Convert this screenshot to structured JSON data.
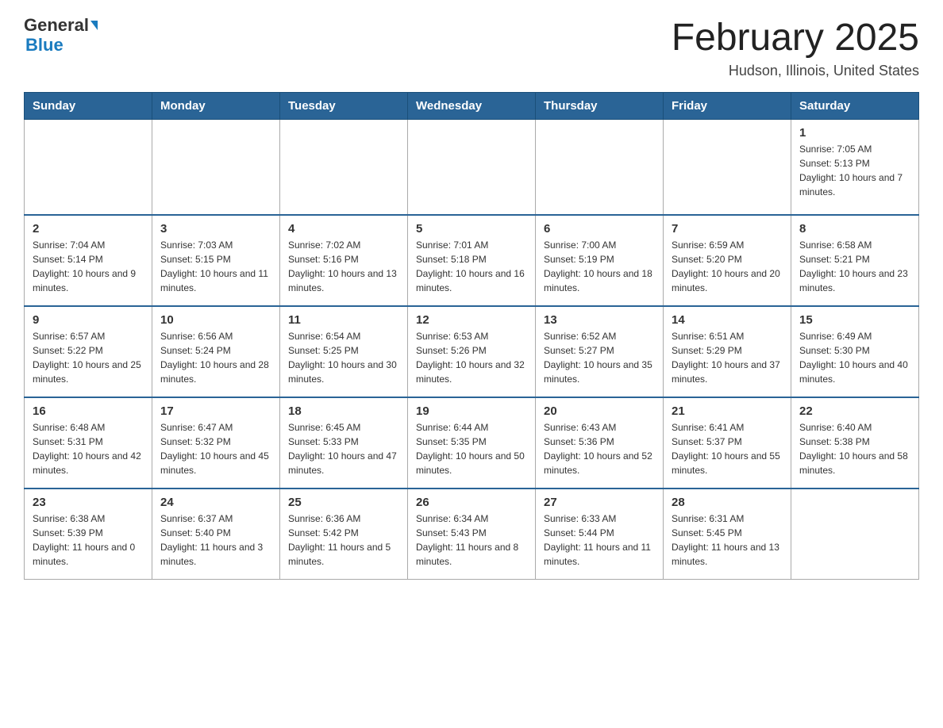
{
  "header": {
    "logo_line1": "General",
    "logo_line2": "Blue",
    "title": "February 2025",
    "subtitle": "Hudson, Illinois, United States"
  },
  "days_of_week": [
    "Sunday",
    "Monday",
    "Tuesday",
    "Wednesday",
    "Thursday",
    "Friday",
    "Saturday"
  ],
  "weeks": [
    [
      {
        "day": "",
        "sunrise": "",
        "sunset": "",
        "daylight": ""
      },
      {
        "day": "",
        "sunrise": "",
        "sunset": "",
        "daylight": ""
      },
      {
        "day": "",
        "sunrise": "",
        "sunset": "",
        "daylight": ""
      },
      {
        "day": "",
        "sunrise": "",
        "sunset": "",
        "daylight": ""
      },
      {
        "day": "",
        "sunrise": "",
        "sunset": "",
        "daylight": ""
      },
      {
        "day": "",
        "sunrise": "",
        "sunset": "",
        "daylight": ""
      },
      {
        "day": "1",
        "sunrise": "Sunrise: 7:05 AM",
        "sunset": "Sunset: 5:13 PM",
        "daylight": "Daylight: 10 hours and 7 minutes."
      }
    ],
    [
      {
        "day": "2",
        "sunrise": "Sunrise: 7:04 AM",
        "sunset": "Sunset: 5:14 PM",
        "daylight": "Daylight: 10 hours and 9 minutes."
      },
      {
        "day": "3",
        "sunrise": "Sunrise: 7:03 AM",
        "sunset": "Sunset: 5:15 PM",
        "daylight": "Daylight: 10 hours and 11 minutes."
      },
      {
        "day": "4",
        "sunrise": "Sunrise: 7:02 AM",
        "sunset": "Sunset: 5:16 PM",
        "daylight": "Daylight: 10 hours and 13 minutes."
      },
      {
        "day": "5",
        "sunrise": "Sunrise: 7:01 AM",
        "sunset": "Sunset: 5:18 PM",
        "daylight": "Daylight: 10 hours and 16 minutes."
      },
      {
        "day": "6",
        "sunrise": "Sunrise: 7:00 AM",
        "sunset": "Sunset: 5:19 PM",
        "daylight": "Daylight: 10 hours and 18 minutes."
      },
      {
        "day": "7",
        "sunrise": "Sunrise: 6:59 AM",
        "sunset": "Sunset: 5:20 PM",
        "daylight": "Daylight: 10 hours and 20 minutes."
      },
      {
        "day": "8",
        "sunrise": "Sunrise: 6:58 AM",
        "sunset": "Sunset: 5:21 PM",
        "daylight": "Daylight: 10 hours and 23 minutes."
      }
    ],
    [
      {
        "day": "9",
        "sunrise": "Sunrise: 6:57 AM",
        "sunset": "Sunset: 5:22 PM",
        "daylight": "Daylight: 10 hours and 25 minutes."
      },
      {
        "day": "10",
        "sunrise": "Sunrise: 6:56 AM",
        "sunset": "Sunset: 5:24 PM",
        "daylight": "Daylight: 10 hours and 28 minutes."
      },
      {
        "day": "11",
        "sunrise": "Sunrise: 6:54 AM",
        "sunset": "Sunset: 5:25 PM",
        "daylight": "Daylight: 10 hours and 30 minutes."
      },
      {
        "day": "12",
        "sunrise": "Sunrise: 6:53 AM",
        "sunset": "Sunset: 5:26 PM",
        "daylight": "Daylight: 10 hours and 32 minutes."
      },
      {
        "day": "13",
        "sunrise": "Sunrise: 6:52 AM",
        "sunset": "Sunset: 5:27 PM",
        "daylight": "Daylight: 10 hours and 35 minutes."
      },
      {
        "day": "14",
        "sunrise": "Sunrise: 6:51 AM",
        "sunset": "Sunset: 5:29 PM",
        "daylight": "Daylight: 10 hours and 37 minutes."
      },
      {
        "day": "15",
        "sunrise": "Sunrise: 6:49 AM",
        "sunset": "Sunset: 5:30 PM",
        "daylight": "Daylight: 10 hours and 40 minutes."
      }
    ],
    [
      {
        "day": "16",
        "sunrise": "Sunrise: 6:48 AM",
        "sunset": "Sunset: 5:31 PM",
        "daylight": "Daylight: 10 hours and 42 minutes."
      },
      {
        "day": "17",
        "sunrise": "Sunrise: 6:47 AM",
        "sunset": "Sunset: 5:32 PM",
        "daylight": "Daylight: 10 hours and 45 minutes."
      },
      {
        "day": "18",
        "sunrise": "Sunrise: 6:45 AM",
        "sunset": "Sunset: 5:33 PM",
        "daylight": "Daylight: 10 hours and 47 minutes."
      },
      {
        "day": "19",
        "sunrise": "Sunrise: 6:44 AM",
        "sunset": "Sunset: 5:35 PM",
        "daylight": "Daylight: 10 hours and 50 minutes."
      },
      {
        "day": "20",
        "sunrise": "Sunrise: 6:43 AM",
        "sunset": "Sunset: 5:36 PM",
        "daylight": "Daylight: 10 hours and 52 minutes."
      },
      {
        "day": "21",
        "sunrise": "Sunrise: 6:41 AM",
        "sunset": "Sunset: 5:37 PM",
        "daylight": "Daylight: 10 hours and 55 minutes."
      },
      {
        "day": "22",
        "sunrise": "Sunrise: 6:40 AM",
        "sunset": "Sunset: 5:38 PM",
        "daylight": "Daylight: 10 hours and 58 minutes."
      }
    ],
    [
      {
        "day": "23",
        "sunrise": "Sunrise: 6:38 AM",
        "sunset": "Sunset: 5:39 PM",
        "daylight": "Daylight: 11 hours and 0 minutes."
      },
      {
        "day": "24",
        "sunrise": "Sunrise: 6:37 AM",
        "sunset": "Sunset: 5:40 PM",
        "daylight": "Daylight: 11 hours and 3 minutes."
      },
      {
        "day": "25",
        "sunrise": "Sunrise: 6:36 AM",
        "sunset": "Sunset: 5:42 PM",
        "daylight": "Daylight: 11 hours and 5 minutes."
      },
      {
        "day": "26",
        "sunrise": "Sunrise: 6:34 AM",
        "sunset": "Sunset: 5:43 PM",
        "daylight": "Daylight: 11 hours and 8 minutes."
      },
      {
        "day": "27",
        "sunrise": "Sunrise: 6:33 AM",
        "sunset": "Sunset: 5:44 PM",
        "daylight": "Daylight: 11 hours and 11 minutes."
      },
      {
        "day": "28",
        "sunrise": "Sunrise: 6:31 AM",
        "sunset": "Sunset: 5:45 PM",
        "daylight": "Daylight: 11 hours and 13 minutes."
      },
      {
        "day": "",
        "sunrise": "",
        "sunset": "",
        "daylight": ""
      }
    ]
  ]
}
